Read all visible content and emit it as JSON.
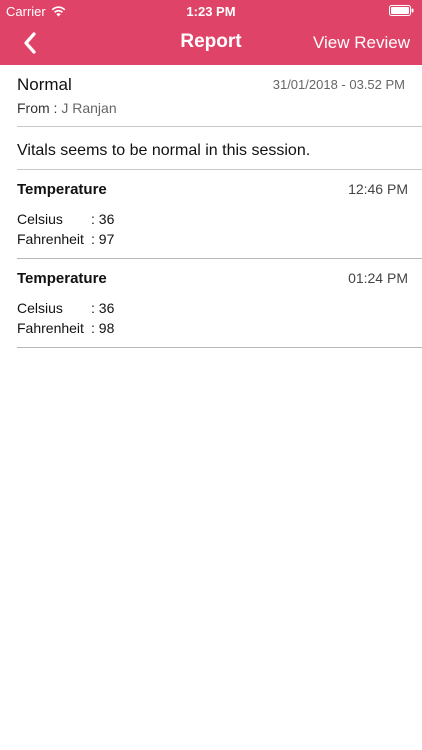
{
  "status_bar": {
    "carrier": "Carrier",
    "time": "1:23 PM",
    "icons": [
      "wifi-icon",
      "battery-icon"
    ]
  },
  "navbar": {
    "title": "Report",
    "right_action": "View Review",
    "back_icon": "chevron-left-icon",
    "color": "#df4468"
  },
  "report": {
    "status": "Normal",
    "date": "31/01/2018 - 03.52 PM",
    "from_label": "From : ",
    "from_name": "J Ranjan",
    "note": "Vitals seems to be normal in this session."
  },
  "readings": [
    {
      "title": "Temperature",
      "time": "12:46 PM",
      "rows": [
        {
          "key": "Celsius",
          "value": ": 36"
        },
        {
          "key": "Fahrenheit",
          "value": ": 97"
        }
      ]
    },
    {
      "title": "Temperature",
      "time": "01:24 PM",
      "rows": [
        {
          "key": "Celsius",
          "value": ": 36"
        },
        {
          "key": "Fahrenheit",
          "value": ": 98"
        }
      ]
    }
  ]
}
